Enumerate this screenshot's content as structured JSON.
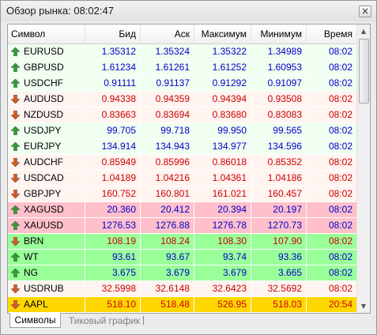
{
  "window": {
    "title": "Обзор рынка: 08:02:47",
    "close_glyph": "×"
  },
  "columns": {
    "symbol": "Символ",
    "bid": "Бид",
    "ask": "Аск",
    "max": "Максимум",
    "min": "Минимум",
    "time": "Время"
  },
  "colors": {
    "up_arrow": "#2fa02f",
    "down_arrow": "#e0551b",
    "up_text": "#0000cc",
    "down_text": "#cc0000",
    "row_up_bg": "#f0fff0",
    "row_down_bg": "#fff4f0",
    "row_pink_bg": "#ffc0cb",
    "row_green_bg": "#99ff99",
    "row_gold_bg": "#ffd700"
  },
  "rows": [
    {
      "symbol": "EURUSD",
      "bid": "1.35312",
      "ask": "1.35324",
      "max": "1.35322",
      "min": "1.34989",
      "time": "08:02",
      "dir": "up",
      "bg": "row_up_bg"
    },
    {
      "symbol": "GBPUSD",
      "bid": "1.61234",
      "ask": "1.61261",
      "max": "1.61252",
      "min": "1.60953",
      "time": "08:02",
      "dir": "up",
      "bg": "row_up_bg"
    },
    {
      "symbol": "USDCHF",
      "bid": "0.91111",
      "ask": "0.91137",
      "max": "0.91292",
      "min": "0.91097",
      "time": "08:02",
      "dir": "up",
      "bg": "row_up_bg"
    },
    {
      "symbol": "AUDUSD",
      "bid": "0.94338",
      "ask": "0.94359",
      "max": "0.94394",
      "min": "0.93508",
      "time": "08:02",
      "dir": "down",
      "bg": "row_down_bg"
    },
    {
      "symbol": "NZDUSD",
      "bid": "0.83663",
      "ask": "0.83694",
      "max": "0.83680",
      "min": "0.83083",
      "time": "08:02",
      "dir": "down",
      "bg": "row_down_bg"
    },
    {
      "symbol": "USDJPY",
      "bid": "99.705",
      "ask": "99.718",
      "max": "99.950",
      "min": "99.565",
      "time": "08:02",
      "dir": "up",
      "bg": "row_up_bg"
    },
    {
      "symbol": "EURJPY",
      "bid": "134.914",
      "ask": "134.943",
      "max": "134.977",
      "min": "134.596",
      "time": "08:02",
      "dir": "up",
      "bg": "row_up_bg"
    },
    {
      "symbol": "AUDCHF",
      "bid": "0.85949",
      "ask": "0.85996",
      "max": "0.86018",
      "min": "0.85352",
      "time": "08:02",
      "dir": "down",
      "bg": "row_down_bg"
    },
    {
      "symbol": "USDCAD",
      "bid": "1.04189",
      "ask": "1.04216",
      "max": "1.04361",
      "min": "1.04186",
      "time": "08:02",
      "dir": "down",
      "bg": "row_down_bg"
    },
    {
      "symbol": "GBPJPY",
      "bid": "160.752",
      "ask": "160.801",
      "max": "161.021",
      "min": "160.457",
      "time": "08:02",
      "dir": "down",
      "bg": "row_down_bg"
    },
    {
      "symbol": "XAGUSD",
      "bid": "20.360",
      "ask": "20.412",
      "max": "20.394",
      "min": "20.197",
      "time": "08:02",
      "dir": "up",
      "bg": "row_pink_bg"
    },
    {
      "symbol": "XAUUSD",
      "bid": "1276.53",
      "ask": "1276.88",
      "max": "1276.78",
      "min": "1270.73",
      "time": "08:02",
      "dir": "up",
      "bg": "row_pink_bg"
    },
    {
      "symbol": "BRN",
      "bid": "108.19",
      "ask": "108.24",
      "max": "108.30",
      "min": "107.90",
      "time": "08:02",
      "dir": "down",
      "bg": "row_green_bg"
    },
    {
      "symbol": "WT",
      "bid": "93.61",
      "ask": "93.67",
      "max": "93.74",
      "min": "93.36",
      "time": "08:02",
      "dir": "up",
      "bg": "row_green_bg"
    },
    {
      "symbol": "NG",
      "bid": "3.675",
      "ask": "3.679",
      "max": "3.679",
      "min": "3.665",
      "time": "08:02",
      "dir": "up",
      "bg": "row_green_bg"
    },
    {
      "symbol": "USDRUB",
      "bid": "32.5998",
      "ask": "32.6148",
      "max": "32.6423",
      "min": "32.5692",
      "time": "08:02",
      "dir": "down",
      "bg": "row_down_bg"
    },
    {
      "symbol": "AAPL",
      "bid": "518.10",
      "ask": "518.48",
      "max": "526.95",
      "min": "518.03",
      "time": "20:54",
      "dir": "down",
      "bg": "row_gold_bg"
    }
  ],
  "tabs": {
    "active": "Символы",
    "other": "Тиковый график"
  },
  "scrollbar": {
    "up_glyph": "▲",
    "down_glyph": "▼"
  }
}
